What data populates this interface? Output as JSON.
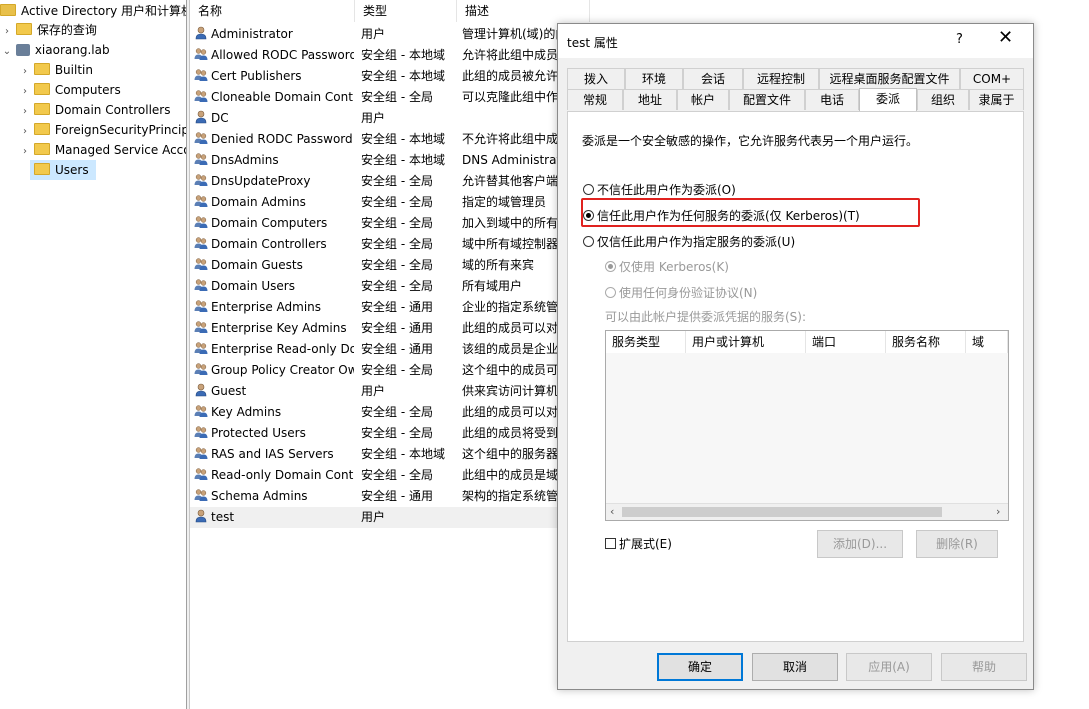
{
  "tree": {
    "root_label": "Active Directory 用户和计算机",
    "items": [
      {
        "label": "保存的查询",
        "chevron": "›"
      },
      {
        "label": "xiaorang.lab",
        "chevron": "⌄"
      },
      {
        "label": "Builtin",
        "chevron": "›"
      },
      {
        "label": "Computers",
        "chevron": "›"
      },
      {
        "label": "Domain Controllers",
        "chevron": "›"
      },
      {
        "label": "ForeignSecurityPrincipals",
        "chevron": "›"
      },
      {
        "label": "Managed Service Accounts",
        "chevron": "›"
      },
      {
        "label": "Users",
        "chevron": ""
      }
    ]
  },
  "list": {
    "headers": {
      "name": "名称",
      "type": "类型",
      "desc": "描述"
    },
    "rows": [
      {
        "name": "Administrator",
        "type": "用户",
        "desc": "管理计算机(域)的内置帐户",
        "icon": "user-icon"
      },
      {
        "name": "Allowed RODC Password Replication Group",
        "type": "安全组 - 本地域",
        "desc": "允许将此组中成员",
        "icon": "group-icon"
      },
      {
        "name": "Cert Publishers",
        "type": "安全组 - 本地域",
        "desc": "此组的成员被允许",
        "icon": "group-icon"
      },
      {
        "name": "Cloneable Domain Controllers",
        "type": "安全组 - 全局",
        "desc": "可以克隆此组中作",
        "icon": "group-icon"
      },
      {
        "name": "DC",
        "type": "用户",
        "desc": "",
        "icon": "user-icon"
      },
      {
        "name": "Denied RODC Password Replication Group",
        "type": "安全组 - 本地域",
        "desc": "不允许将此组中成",
        "icon": "group-icon"
      },
      {
        "name": "DnsAdmins",
        "type": "安全组 - 本地域",
        "desc": "DNS Administrators",
        "icon": "group-icon"
      },
      {
        "name": "DnsUpdateProxy",
        "type": "安全组 - 全局",
        "desc": "允许替其他客户端",
        "icon": "group-icon"
      },
      {
        "name": "Domain Admins",
        "type": "安全组 - 全局",
        "desc": "指定的域管理员",
        "icon": "group-icon"
      },
      {
        "name": "Domain Computers",
        "type": "安全组 - 全局",
        "desc": "加入到域中的所有",
        "icon": "group-icon"
      },
      {
        "name": "Domain Controllers",
        "type": "安全组 - 全局",
        "desc": "域中所有域控制器",
        "icon": "group-icon"
      },
      {
        "name": "Domain Guests",
        "type": "安全组 - 全局",
        "desc": "域的所有来宾",
        "icon": "group-icon"
      },
      {
        "name": "Domain Users",
        "type": "安全组 - 全局",
        "desc": "所有域用户",
        "icon": "group-icon"
      },
      {
        "name": "Enterprise Admins",
        "type": "安全组 - 通用",
        "desc": "企业的指定系统管",
        "icon": "group-icon"
      },
      {
        "name": "Enterprise Key Admins",
        "type": "安全组 - 通用",
        "desc": "此组的成员可以对",
        "icon": "group-icon"
      },
      {
        "name": "Enterprise Read-only Domain Controllers",
        "type": "安全组 - 通用",
        "desc": "该组的成员是企业",
        "icon": "group-icon"
      },
      {
        "name": "Group Policy Creator Owners",
        "type": "安全组 - 全局",
        "desc": "这个组中的成员可",
        "icon": "group-icon"
      },
      {
        "name": "Guest",
        "type": "用户",
        "desc": "供来宾访问计算机",
        "icon": "user-icon"
      },
      {
        "name": "Key Admins",
        "type": "安全组 - 全局",
        "desc": "此组的成员可以对",
        "icon": "group-icon"
      },
      {
        "name": "Protected Users",
        "type": "安全组 - 全局",
        "desc": "此组的成员将受到",
        "icon": "group-icon"
      },
      {
        "name": "RAS and IAS Servers",
        "type": "安全组 - 本地域",
        "desc": "这个组中的服务器",
        "icon": "group-icon"
      },
      {
        "name": "Read-only Domain Controllers",
        "type": "安全组 - 全局",
        "desc": "此组中的成员是域",
        "icon": "group-icon"
      },
      {
        "name": "Schema Admins",
        "type": "安全组 - 通用",
        "desc": "架构的指定系统管",
        "icon": "group-icon"
      },
      {
        "name": "test",
        "type": "用户",
        "desc": "",
        "icon": "user-icon"
      }
    ]
  },
  "dialog": {
    "title": "test 属性",
    "help": "?",
    "close": "✕",
    "tabs_row1": [
      "拨入",
      "环境",
      "会话",
      "远程控制",
      "远程桌面服务配置文件",
      "COM+"
    ],
    "tabs_row2": [
      "常规",
      "地址",
      "帐户",
      "配置文件",
      "电话",
      "委派",
      "组织",
      "隶属于"
    ],
    "active_tab": "委派",
    "intro": "委派是一个安全敏感的操作，它允许服务代表另一个用户运行。",
    "opt_none": "不信任此用户作为委派(O)",
    "opt_any": "信任此用户作为任何服务的委派(仅 Kerberos)(T)",
    "opt_specified": "仅信任此用户作为指定服务的委派(U)",
    "sub_kerberos": "仅使用 Kerberos(K)",
    "sub_any_auth": "使用任何身份验证协议(N)",
    "services_label": "可以由此帐户提供委派凭据的服务(S):",
    "svc_columns": [
      "服务类型",
      "用户或计算机",
      "端口",
      "服务名称",
      "域"
    ],
    "expanded": "扩展式(E)",
    "add": "添加(D)...",
    "remove": "删除(R)",
    "ok": "确定",
    "cancel": "取消",
    "apply": "应用(A)",
    "help_btn": "帮助"
  }
}
